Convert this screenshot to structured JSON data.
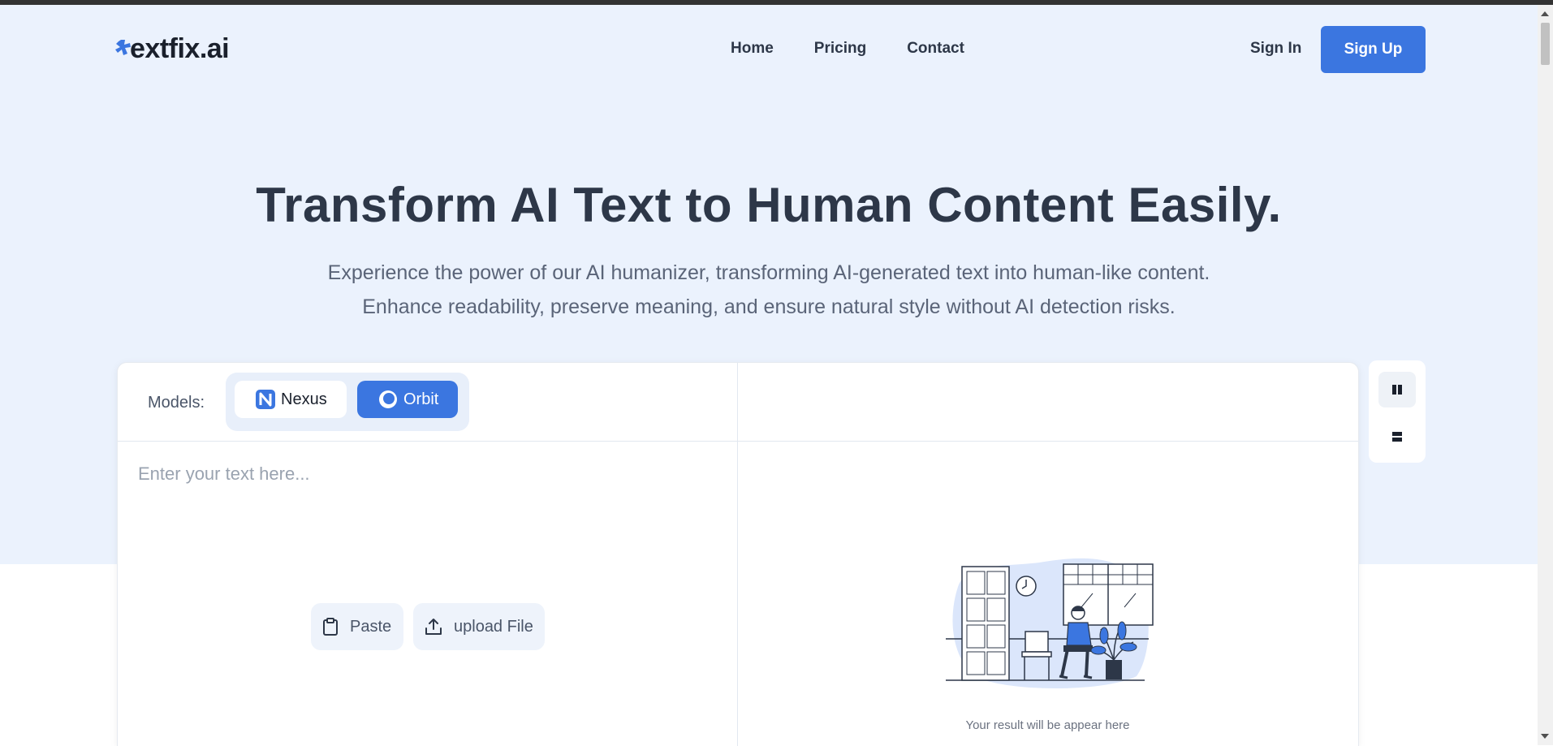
{
  "header": {
    "logo_text": "extfix.ai",
    "nav": [
      "Home",
      "Pricing",
      "Contact"
    ],
    "sign_in": "Sign In",
    "sign_up": "Sign Up"
  },
  "hero": {
    "title": "Transform AI Text to Human Content Easily.",
    "subtitle_line1": "Experience the power of our AI humanizer, transforming AI-generated text into human-like content.",
    "subtitle_line2": "Enhance readability, preserve meaning, and ensure natural style without AI detection risks."
  },
  "editor": {
    "models_label": "Models:",
    "models": [
      {
        "label": "Nexus",
        "icon": "nexus-icon",
        "selected": false
      },
      {
        "label": "Orbit",
        "icon": "orbit-icon",
        "selected": true
      }
    ],
    "input_placeholder": "Enter your text here...",
    "paste_label": "Paste",
    "upload_label": "upload File",
    "result_placeholder": "Your result will be appear here"
  },
  "layout_toggle": {
    "options": [
      "columns-layout-icon",
      "rows-layout-icon"
    ],
    "selected": "columns-layout-icon"
  },
  "colors": {
    "accent": "#3b76e0",
    "hero_bg": "#ebf2fd",
    "text_dark": "#2d3748"
  }
}
